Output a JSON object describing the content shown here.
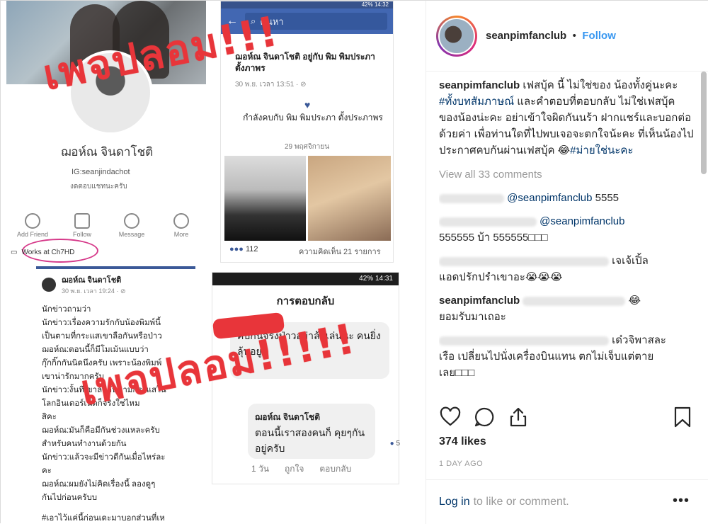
{
  "collage": {
    "stamp_text": "เพจปลอม!!!",
    "stamp_text_2": "เพจปลอม!!!!!",
    "fb_profile": {
      "name": "ฌอห์ณ จินดาโชติ",
      "ig": "IG:seanjindachot",
      "reply_note": "งดตอบแชทนะครับ",
      "actions": [
        "Add Friend",
        "Follow",
        "Message",
        "More"
      ],
      "works_at": "Works at Ch7HD"
    },
    "post1": {
      "author": "ฌอห์ณ จินดาโชติ",
      "time": "30 พ.ย. เวลา 19:24 · ⊘",
      "lines": [
        "นักข่าวถามว่า",
        "นักข่าว:เรื่องความรักกับน้องพิมพ์นี้",
        "เป็นตามที่กระแสเขาลือกันหรือป่าว",
        "ฌอห์ณ:ตอนนี้ก็มีโมเม้นแบบว่า",
        "กุ๊กกิ๊กกันนิดนึงครับ เพราะน้องพิมพ์",
        "เขาน่ารักมากครับ",
        "นักข่าว:งั้นที่เขาลือกันตามกระแสใน",
        "โลกอินเตอร์เน็ตก็จริงใช่ไหม",
        "สิคะ",
        "ฌอห์ณ:มันก็คือมีกันช่วงแหละครับ",
        "สำหรับคนทำงานด้วยกัน",
        "นักข่าว:แล้วจะมีข่าวดีกันเมื่อไหร่ละ",
        "คะ",
        "ฌอห์ณ:ผมยังไม่คิดเรื่องนี้ ลองดูๆ",
        "กันไปก่อนครับบ"
      ],
      "tag_line": "#เอาไว้แค่นี้ก่อนเดะมาบอกส่วนที่เห"
    },
    "phone1": {
      "status": "42% 14:32",
      "search_placeholder": "ค้นหา",
      "name_line": "ฌอห์ณ จินดาโชติ อยู่กับ พิม พิมประภา ตั้งภาพร",
      "time": "30 พ.ย. เวลา 13:51 · ⊘",
      "relationship": "กำลังคบกับ พิม พิมประภา ตั้งประภาพร",
      "date": "29 พฤศจิกายน",
      "reactions": "112",
      "comments": "ความคิดเห็น 21 รายการ"
    },
    "phone2": {
      "status": "42% 14:31",
      "title": "การตอบกลับ",
      "bubble1": "คบกันจริงป่าวอย่าล้อเล่นนะ คนยิ่งลุ้นอยู่",
      "bubble2_name": "ฌอห์ณ จินดาโชติ",
      "bubble2": "ตอนนี้เราสองคนก็ คุยๆกันอยู่ครับ",
      "bubble2_react": "5",
      "foot": [
        "1 วัน",
        "ถูกใจ",
        "ตอบกลับ"
      ]
    }
  },
  "panel": {
    "username": "seanpimfanclub",
    "dot": "•",
    "follow_label": "Follow",
    "caption": {
      "user": "seanpimfanclub",
      "text1": " เฟสบุ้ค นี้ ไม่ใช่ของ น้องทั้งคู่นะคะ ",
      "hashtag1": "#ทั้งบทสัมภาษณ์",
      "text2": " และคำตอบที่ตอบกลับ ไม่ใช่เฟสบุ้คของน้องน่ะคะ อย่าเข้าใจผิดกันนร้า ฝากแชร์และบอกต่อด้วยค่า เพื่อท่านใดที่ไปพบเจอจะตกใจน้ะคะ ที่เห็นน้องไปประกาศคบกันผ่านเฟสบุ้ค 😂",
      "hashtag2": "#ม่ายใช่นะคะ"
    },
    "view_all": "View all 33 comments",
    "comments": [
      {
        "mention": "@seanpimfanclub",
        "text": " 5555"
      },
      {
        "mention": "@seanpimfanclub",
        "text": "555555 บ้า 555555□□□"
      },
      {
        "text": "เจเจ้เปิ้ล",
        "text2": "แอดปรักปรำเขาอะ😭😭😭"
      },
      {
        "user": "seanpimfanclub",
        "emoji": "😂",
        "text": "ยอมรับมาเถอะ"
      },
      {
        "text": "เด๋วจิพาสละ",
        "text2": "เรือ เปลี่ยนไปนั่งเครื่องบินแทน ตกไม่เจ็บแต่ตาย",
        "text3": "เลย□□□"
      }
    ],
    "likes": "374 likes",
    "ago": "1 DAY AGO",
    "login_label": "Log in",
    "login_suffix": "to like or comment.",
    "more": "•••"
  }
}
